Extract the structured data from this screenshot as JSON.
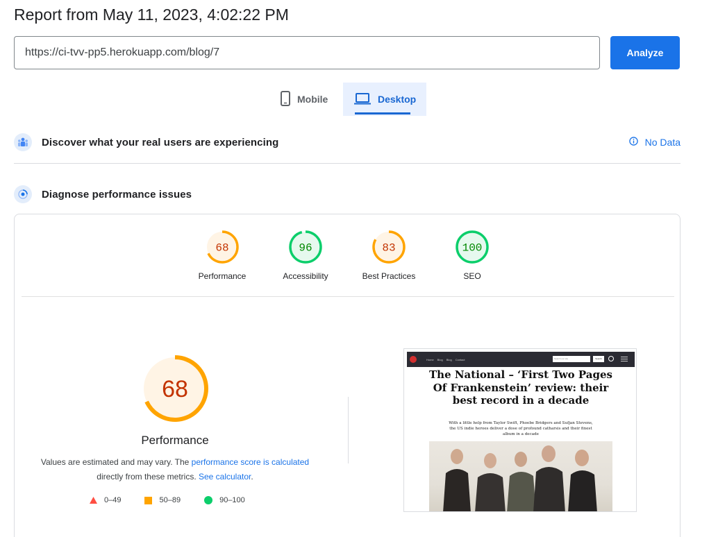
{
  "report": {
    "title": "Report from May 11, 2023, 4:02:22 PM"
  },
  "url_bar": {
    "value": "https://ci-tvv-pp5.herokuapp.com/blog/7",
    "analyze_label": "Analyze"
  },
  "tabs": [
    {
      "label": "Mobile",
      "icon": "phone-icon",
      "selected": false
    },
    {
      "label": "Desktop",
      "icon": "laptop-icon",
      "selected": true
    }
  ],
  "field_data": {
    "title": "Discover what your real users are experiencing",
    "status": "No Data",
    "icon": "users-icon"
  },
  "lab_data": {
    "title": "Diagnose performance issues",
    "icon": "lighthouse-icon"
  },
  "gauges": [
    {
      "label": "Performance",
      "score": 68,
      "level": "average"
    },
    {
      "label": "Accessibility",
      "score": 96,
      "level": "pass"
    },
    {
      "label": "Best Practices",
      "score": 83,
      "level": "average"
    },
    {
      "label": "SEO",
      "score": 100,
      "level": "pass"
    }
  ],
  "colors": {
    "pass": "#0cce6b",
    "pass_text": "#008800",
    "pass_bg": "#e6f9ee",
    "average": "#ffa400",
    "average_text": "#c33300",
    "average_bg": "#fff4e5",
    "fail": "#ff4e42",
    "accent": "#1a73e8"
  },
  "performance": {
    "score": 68,
    "label": "Performance",
    "note_prefix": "Values are estimated and may vary. The ",
    "note_link1": "performance score is calculated",
    "note_middle": " directly from these metrics. ",
    "note_link2": "See calculator",
    "note_suffix": "."
  },
  "legend": [
    {
      "range": "0–49",
      "shape": "triangle",
      "color": "#ff4e42"
    },
    {
      "range": "50–89",
      "shape": "square",
      "color": "#ffa400"
    },
    {
      "range": "90–100",
      "shape": "circle",
      "color": "#0cce6b"
    }
  ],
  "screenshot": {
    "nav_links": [
      "Home",
      "Blog",
      "Blog",
      "Contact"
    ],
    "search_placeholder": "Search our site",
    "search_button": "Search",
    "headline": "The National – ‘First Two Pages Of Frankenstein’ review: their best record in a decade",
    "subheadline": "With a little help from Taylor Swift, Phoebe Bridgers and Sufjan Stevens, the US indie heroes deliver a dose of profound catharsis and their finest album in a decade"
  }
}
